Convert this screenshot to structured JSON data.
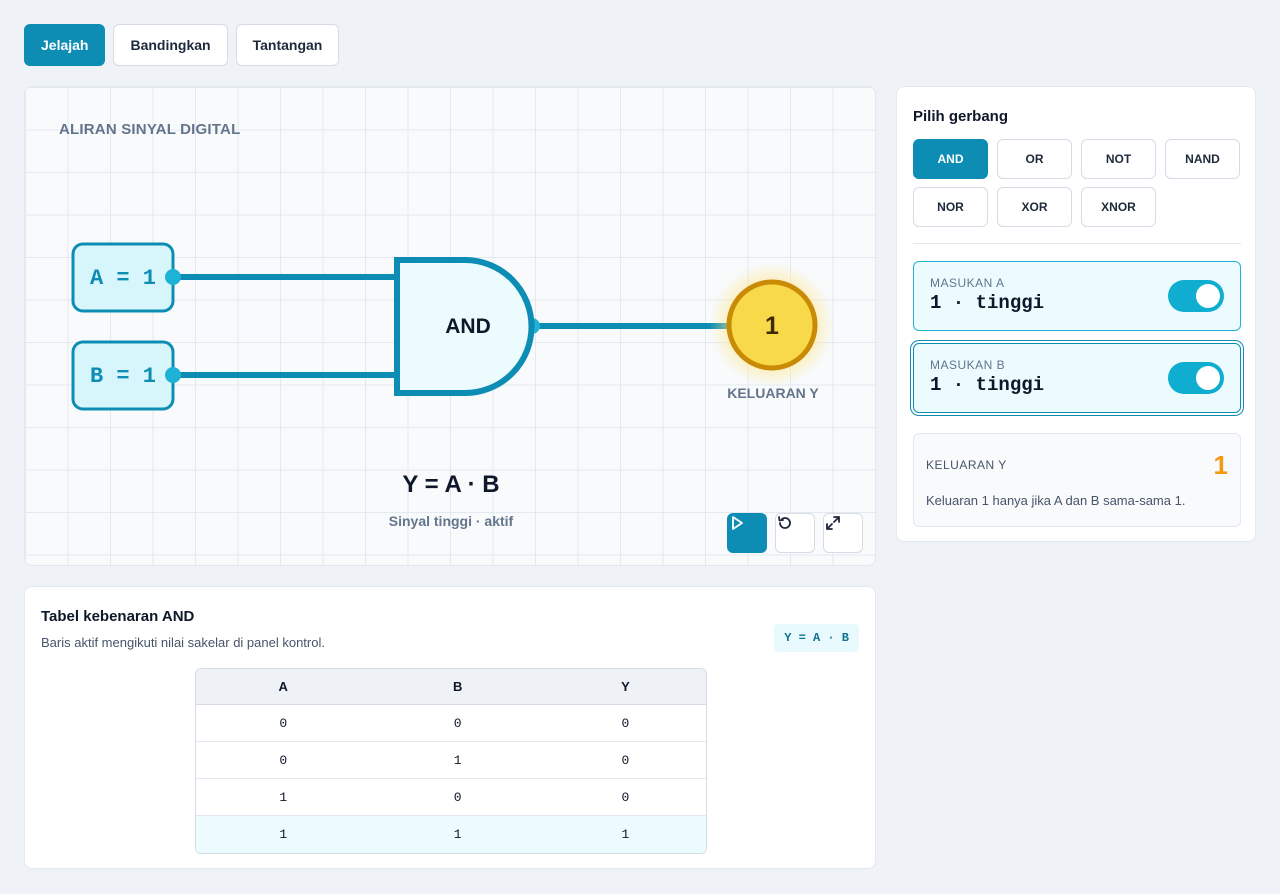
{
  "tabs": [
    {
      "label": "Jelajah",
      "active": true
    },
    {
      "label": "Bandingkan",
      "active": false
    },
    {
      "label": "Tantangan",
      "active": false
    }
  ],
  "canvas": {
    "title": "ALIRAN SINYAL DIGITAL",
    "input_a": "A = 1",
    "input_b": "B = 1",
    "gate_label": "AND",
    "output_value": "1",
    "output_label": "KELUARAN Y",
    "formula": "Y = A · B",
    "formula_sub": "Sinyal tinggi · aktif",
    "controls": [
      "play-icon",
      "reset-icon",
      "fullscreen-icon"
    ]
  },
  "panel": {
    "title": "Pilih gerbang",
    "gates": [
      "AND",
      "OR",
      "NOT",
      "NAND",
      "NOR",
      "XOR",
      "XNOR"
    ],
    "selected_gate": "AND",
    "input_a": {
      "label": "MASUKAN A",
      "value": "1 · tinggi",
      "on": true
    },
    "input_b": {
      "label": "MASUKAN B",
      "value": "1 · tinggi",
      "on": true
    },
    "output": {
      "label": "KELUARAN Y",
      "value": "1",
      "description": "Keluaran 1 hanya jika A dan B sama-sama 1."
    }
  },
  "truth_table": {
    "title": "Tabel kebenaran AND",
    "subtitle": "Baris aktif mengikuti nilai sakelar di panel kontrol.",
    "formula_pill": "Y = A · B",
    "headers": [
      "A",
      "B",
      "Y"
    ],
    "rows": [
      [
        "0",
        "0",
        "0"
      ],
      [
        "0",
        "1",
        "0"
      ],
      [
        "1",
        "0",
        "0"
      ],
      [
        "1",
        "1",
        "1"
      ]
    ],
    "active_row": 3
  },
  "colors": {
    "accent": "#0e8db4",
    "wire": "#0e8db4",
    "output_on": "#f8d94a",
    "output_value": "#f29b12"
  }
}
